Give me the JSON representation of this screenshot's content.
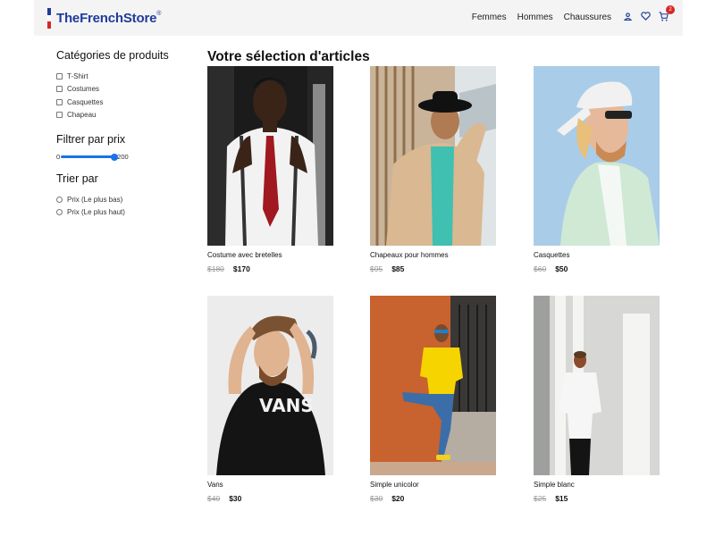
{
  "header": {
    "logo": "TheFrenchStore",
    "logo_mark": "®",
    "nav": [
      "Femmes",
      "Hommes",
      "Chaussures"
    ],
    "cart_count": "2",
    "icons": [
      "user-icon",
      "heart-icon",
      "cart-icon"
    ]
  },
  "sidebar": {
    "categories_title": "Catégories de produits",
    "categories": [
      "T-Shirt",
      "Costumes",
      "Casquettes",
      "Chapeau"
    ],
    "price_title": "Filtrer par prix",
    "price_min": "0",
    "price_max": "200",
    "sort_title": "Trier par",
    "sort_options": [
      "Prix (Le plus bas)",
      "Prix (Le plus haut)"
    ]
  },
  "main": {
    "title": "Votre sélection d'articles",
    "products": [
      {
        "name": "Costume avec bretelles",
        "old_price": "$180",
        "price": "$170"
      },
      {
        "name": "Chapeaux pour hommes",
        "old_price": "$95",
        "price": "$85"
      },
      {
        "name": "Casquettes",
        "old_price": "$60",
        "price": "$50"
      },
      {
        "name": "Vans",
        "old_price": "$40",
        "price": "$30"
      },
      {
        "name": "Simple unicolor",
        "old_price": "$30",
        "price": "$20"
      },
      {
        "name": "Simple blanc",
        "old_price": "$25",
        "price": "$15"
      }
    ]
  },
  "colors": {
    "brand_blue": "#1f3c9a",
    "french_red": "#d62828",
    "slider_blue": "#1a73e8"
  }
}
